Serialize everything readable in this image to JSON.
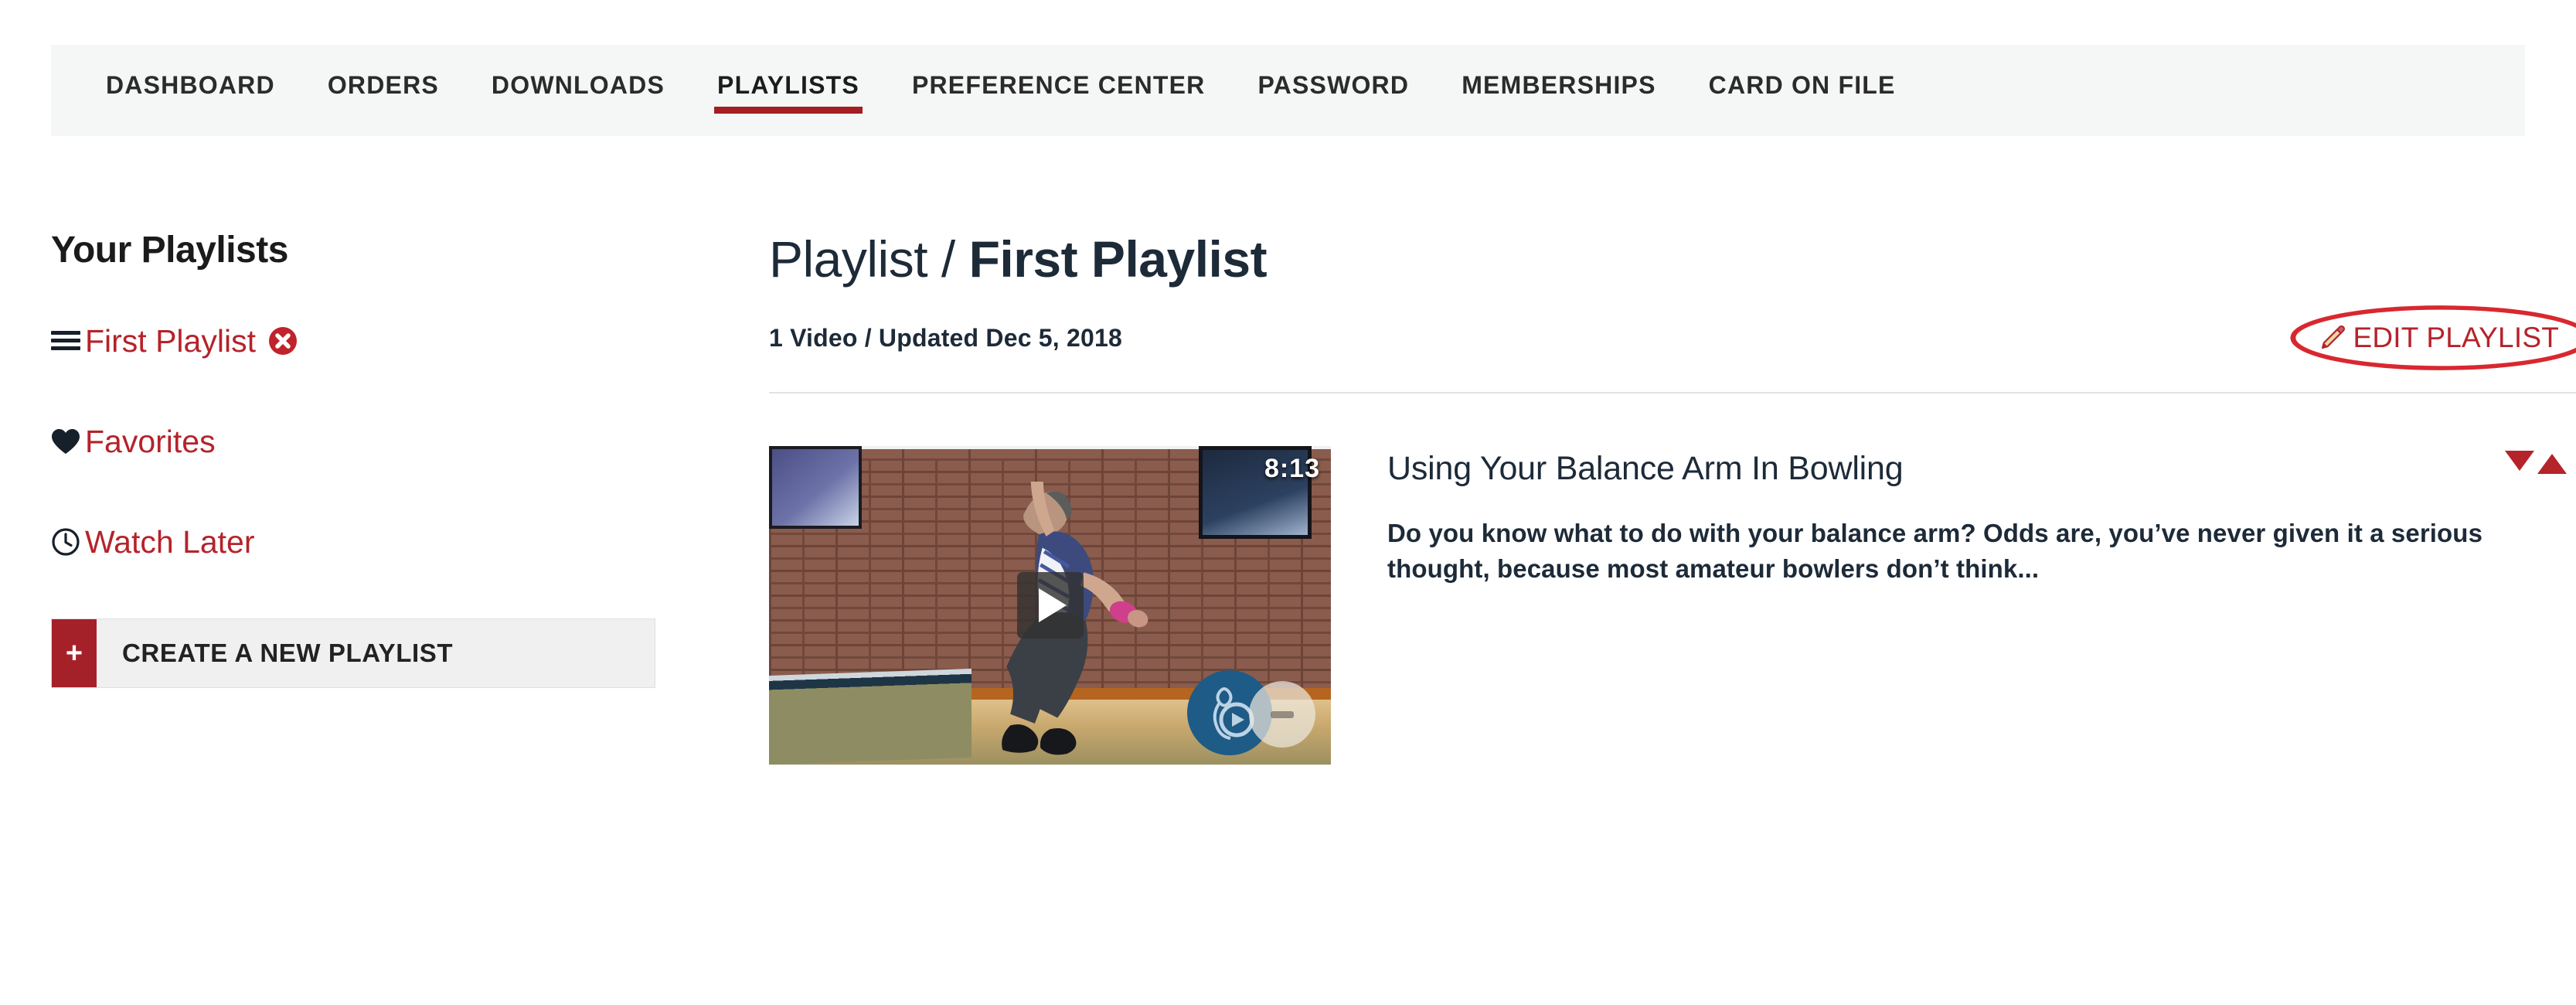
{
  "account_nav": {
    "items": [
      {
        "label": "DASHBOARD",
        "active": false
      },
      {
        "label": "ORDERS",
        "active": false
      },
      {
        "label": "DOWNLOADS",
        "active": false
      },
      {
        "label": "PLAYLISTS",
        "active": true
      },
      {
        "label": "PREFERENCE CENTER",
        "active": false
      },
      {
        "label": "PASSWORD",
        "active": false
      },
      {
        "label": "MEMBERSHIPS",
        "active": false
      },
      {
        "label": "CARD ON FILE",
        "active": false
      }
    ]
  },
  "sidebar": {
    "title": "Your Playlists",
    "items": [
      {
        "label": "First Playlist",
        "icon": "drag-handle-icon",
        "deletable": true
      },
      {
        "label": "Favorites",
        "icon": "heart-icon",
        "deletable": false
      },
      {
        "label": "Watch Later",
        "icon": "clock-icon",
        "deletable": false
      }
    ],
    "create_button": {
      "plus": "+",
      "label": "CREATE A NEW PLAYLIST"
    }
  },
  "main": {
    "heading_prefix": "Playlist / ",
    "heading_name": "First Playlist",
    "meta": "1 Video / Updated Dec 5, 2018",
    "edit_link": "EDIT PLAYLIST",
    "edit_icon": "pencil-icon"
  },
  "video": {
    "duration": "8:13",
    "title": "Using Your Balance Arm In Bowling",
    "description": "Do you know what to do with your balance arm? Odds are, you’ve never given it a serious thought, because most amateur bowlers don’t think...",
    "play_icon": "play-icon",
    "brand_icon": "bowling-brand-icon",
    "sort_down_icon": "triangle-down-icon",
    "sort_up_icon": "triangle-up-icon"
  },
  "colors": {
    "accent_red": "#b5232b",
    "underline_red": "#a41e22",
    "button_red": "#a5212a",
    "nav_bg": "#f5f7f7",
    "heading": "#1d2a38"
  }
}
